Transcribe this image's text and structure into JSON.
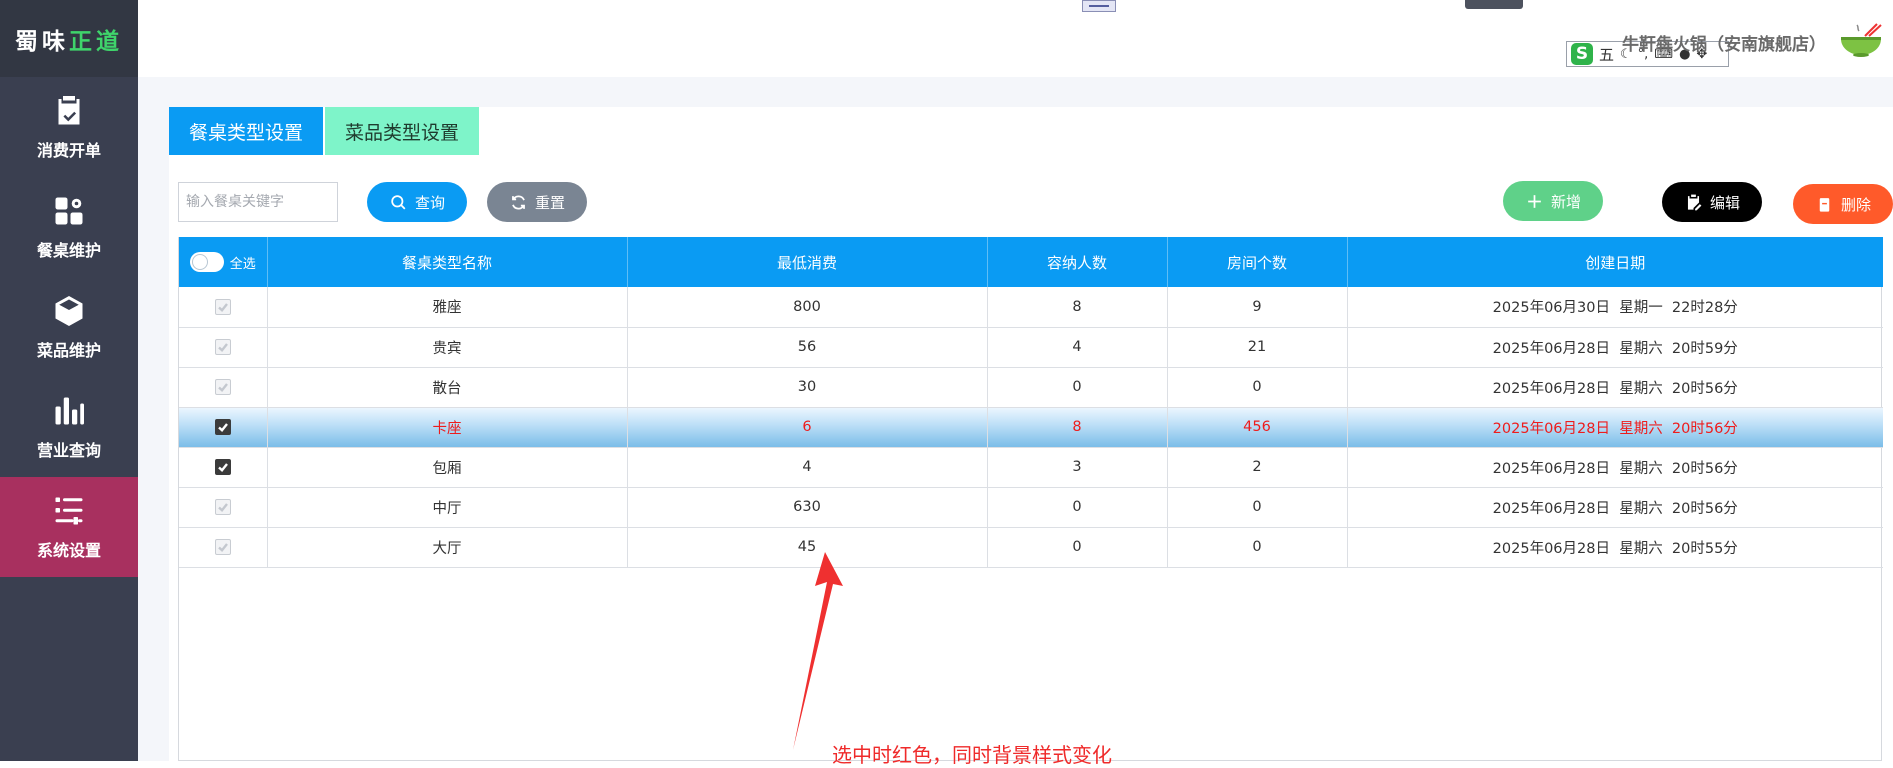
{
  "app": {
    "logo_part1": "蜀味",
    "logo_part2": "正道",
    "store_name": "牛靬犇火锅（安南旗舰店）"
  },
  "colors": {
    "sidebar_bg": "#3a3f50",
    "sidebar_active": "#a8305f",
    "primary": "#0a9bf3",
    "tab_inactive": "#7ef4c9",
    "add_button": "#5fd189",
    "delete_button": "#ff5a2a",
    "selected_text": "#ee1c1c"
  },
  "sidebar": {
    "items": [
      {
        "label": "消费开单",
        "icon": "clipboard-check-icon"
      },
      {
        "label": "餐桌维护",
        "icon": "grid-gear-icon"
      },
      {
        "label": "菜品维护",
        "icon": "cube-icon"
      },
      {
        "label": "营业查询",
        "icon": "bar-chart-icon"
      },
      {
        "label": "系统设置",
        "icon": "settings-list-icon",
        "active": true
      }
    ]
  },
  "ime": {
    "mode": "五",
    "logo": "S"
  },
  "tabs": [
    {
      "label": "餐桌类型设置",
      "active": true
    },
    {
      "label": "菜品类型设置",
      "active": false
    }
  ],
  "toolbar": {
    "search_placeholder": "输入餐桌关键字",
    "search_value": "",
    "query_label": "查询",
    "reset_label": "重置",
    "add_label": "新增",
    "edit_label": "编辑",
    "delete_label": "删除"
  },
  "table": {
    "select_all_label": "全选",
    "columns": [
      "餐桌类型名称",
      "最低消费",
      "容纳人数",
      "房间个数",
      "创建日期"
    ],
    "rows": [
      {
        "name": "雅座",
        "min_spend": "800",
        "capacity": "8",
        "rooms": "9",
        "created": "2025年06月30日  星期一  22时28分",
        "checked": false,
        "selected": false
      },
      {
        "name": "贵宾",
        "min_spend": "56",
        "capacity": "4",
        "rooms": "21",
        "created": "2025年06月28日  星期六  20时59分",
        "checked": false,
        "selected": false
      },
      {
        "name": "散台",
        "min_spend": "30",
        "capacity": "0",
        "rooms": "0",
        "created": "2025年06月28日  星期六  20时56分",
        "checked": false,
        "selected": false
      },
      {
        "name": "卡座",
        "min_spend": "6",
        "capacity": "8",
        "rooms": "456",
        "created": "2025年06月28日  星期六  20时56分",
        "checked": true,
        "selected": true
      },
      {
        "name": "包厢",
        "min_spend": "4",
        "capacity": "3",
        "rooms": "2",
        "created": "2025年06月28日  星期六  20时56分",
        "checked": true,
        "selected": false
      },
      {
        "name": "中厅",
        "min_spend": "630",
        "capacity": "0",
        "rooms": "0",
        "created": "2025年06月28日  星期六  20时56分",
        "checked": false,
        "selected": false
      },
      {
        "name": "大厅",
        "min_spend": "45",
        "capacity": "0",
        "rooms": "0",
        "created": "2025年06月28日  星期六  20时55分",
        "checked": false,
        "selected": false
      }
    ]
  },
  "annotation": {
    "text": "选中时红色，同时背景样式变化"
  }
}
